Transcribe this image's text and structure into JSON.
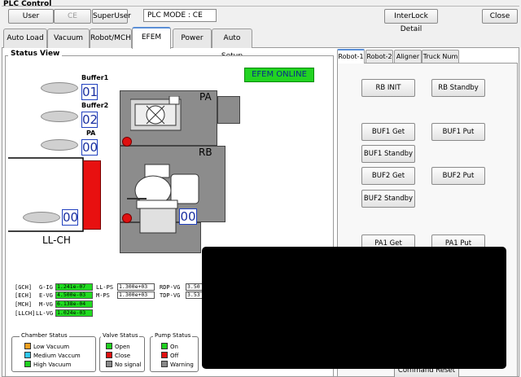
{
  "app": {
    "title": "PLC Control"
  },
  "topbar": {
    "user_label": "User",
    "ce_label": "CE",
    "superuser_label": "SuperUser",
    "plc_mode": "PLC MODE : CE",
    "interlock_label": "InterLock Detail",
    "close_label": "Close"
  },
  "main_tabs": [
    {
      "label": "Auto Load"
    },
    {
      "label": "Vacuum"
    },
    {
      "label": "Robot/MCH"
    },
    {
      "label": "EFEM",
      "active": true
    },
    {
      "label": "Power"
    },
    {
      "label": "Auto Setup"
    }
  ],
  "status_view": {
    "title": "Status View",
    "online_label": "EFEM ONLINE",
    "buffers": [
      {
        "label": "Buffer1",
        "value": "01"
      },
      {
        "label": "Buffer2",
        "value": "02"
      },
      {
        "label": "PA",
        "value": "00"
      }
    ],
    "llch": {
      "label": "LL-CH",
      "value": "00"
    },
    "pa_label": "PA",
    "rb_label": "RB",
    "rb_value": "00"
  },
  "gauges": {
    "rows": [
      {
        "group": "[GCH]",
        "name": "G-IG",
        "value": "1.241e-07",
        "color": "green"
      },
      {
        "group": "[ECH]",
        "name": "E-VG",
        "value": "4.500e-03",
        "color": "green"
      },
      {
        "group": "[MCH]",
        "name": "M-VG",
        "value": "6.138e-04",
        "color": "green"
      },
      {
        "group": "[LLCH]",
        "name": "LL-VG",
        "value": "1.024e-03",
        "color": "green"
      }
    ],
    "mid": [
      {
        "name": "LL-PS",
        "value": "1.300e+03"
      },
      {
        "name": "M-PS",
        "value": "1.300e+03"
      }
    ],
    "right": [
      {
        "name": "RDP-VG",
        "value": "3.50"
      },
      {
        "name": "TDP-VG",
        "value": "3.53"
      }
    ]
  },
  "legend": {
    "chamber": {
      "title": "Chamber Status",
      "items": [
        {
          "label": "Low Vacuum",
          "color": "#f0a020"
        },
        {
          "label": "Medium Vaccum",
          "color": "#30c8f0"
        },
        {
          "label": "High Vacuum",
          "color": "#20d020"
        }
      ]
    },
    "valve": {
      "title": "Valve Status",
      "items": [
        {
          "label": "Open",
          "color": "#20d020"
        },
        {
          "label": "Close",
          "color": "#e01010"
        },
        {
          "label": "No signal",
          "color": "#888888"
        }
      ]
    },
    "pump": {
      "title": "Pump Status",
      "items": [
        {
          "label": "On",
          "color": "#20d020"
        },
        {
          "label": "Off",
          "color": "#e01010"
        },
        {
          "label": "Warning",
          "color": "#888888"
        }
      ]
    }
  },
  "robot_tabs": [
    {
      "label": "Robot-1",
      "active": true
    },
    {
      "label": "Robot-2"
    },
    {
      "label": "Aligner"
    },
    {
      "label": "Truck Num"
    }
  ],
  "robot_buttons": {
    "rb_init": "RB INIT",
    "rb_standby": "RB Standby",
    "buf1_get": "BUF1 Get",
    "buf1_put": "BUF1 Put",
    "buf1_standby": "BUF1 Standby",
    "buf2_get": "BUF2 Get",
    "buf2_put": "BUF2 Put",
    "buf2_standby": "BUF2 Standby",
    "pa1_get": "PA1 Get",
    "pa1_put": "PA1 Put",
    "command_reset": "Command Reset"
  }
}
